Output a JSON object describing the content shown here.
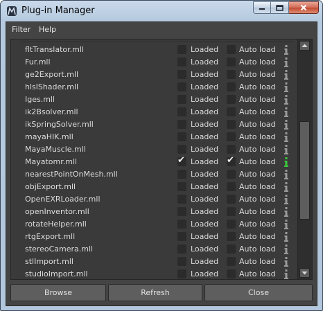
{
  "window": {
    "title": "Plug-in Manager",
    "controls": {
      "minimize": "minimize-icon",
      "maximize": "maximize-icon",
      "close": "close-icon"
    }
  },
  "menubar": {
    "items": [
      "Filter",
      "Help"
    ]
  },
  "plugin_list": {
    "loaded_label": "Loaded",
    "autoload_label": "Auto load",
    "info_icon": "info-icon",
    "info_color_default": "#9a9a9a",
    "info_color_loaded": "#3cc83c",
    "items": [
      {
        "name": "fltTranslator.mll",
        "loaded": false,
        "autoload": false
      },
      {
        "name": "Fur.mll",
        "loaded": false,
        "autoload": false
      },
      {
        "name": "ge2Export.mll",
        "loaded": false,
        "autoload": false
      },
      {
        "name": "hlslShader.mll",
        "loaded": false,
        "autoload": false
      },
      {
        "name": "Iges.mll",
        "loaded": false,
        "autoload": false
      },
      {
        "name": "ik2Bsolver.mll",
        "loaded": false,
        "autoload": false
      },
      {
        "name": "ikSpringSolver.mll",
        "loaded": false,
        "autoload": false
      },
      {
        "name": "mayaHIK.mll",
        "loaded": false,
        "autoload": false
      },
      {
        "name": "MayaMuscle.mll",
        "loaded": false,
        "autoload": false
      },
      {
        "name": "Mayatomr.mll",
        "loaded": true,
        "autoload": true
      },
      {
        "name": "nearestPointOnMesh.mll",
        "loaded": false,
        "autoload": false
      },
      {
        "name": "objExport.mll",
        "loaded": false,
        "autoload": false
      },
      {
        "name": "OpenEXRLoader.mll",
        "loaded": false,
        "autoload": false
      },
      {
        "name": "openInventor.mll",
        "loaded": false,
        "autoload": false
      },
      {
        "name": "rotateHelper.mll",
        "loaded": false,
        "autoload": false
      },
      {
        "name": "rtgExport.mll",
        "loaded": false,
        "autoload": false
      },
      {
        "name": "stereoCamera.mll",
        "loaded": false,
        "autoload": false
      },
      {
        "name": "stlImport.mll",
        "loaded": false,
        "autoload": false
      },
      {
        "name": "studioImport.mll",
        "loaded": false,
        "autoload": false
      }
    ]
  },
  "buttons": {
    "browse": "Browse",
    "refresh": "Refresh",
    "close": "Close"
  },
  "colors": {
    "background": "#444444",
    "list_background": "#3a3a3a",
    "text": "#dcdcdc"
  }
}
